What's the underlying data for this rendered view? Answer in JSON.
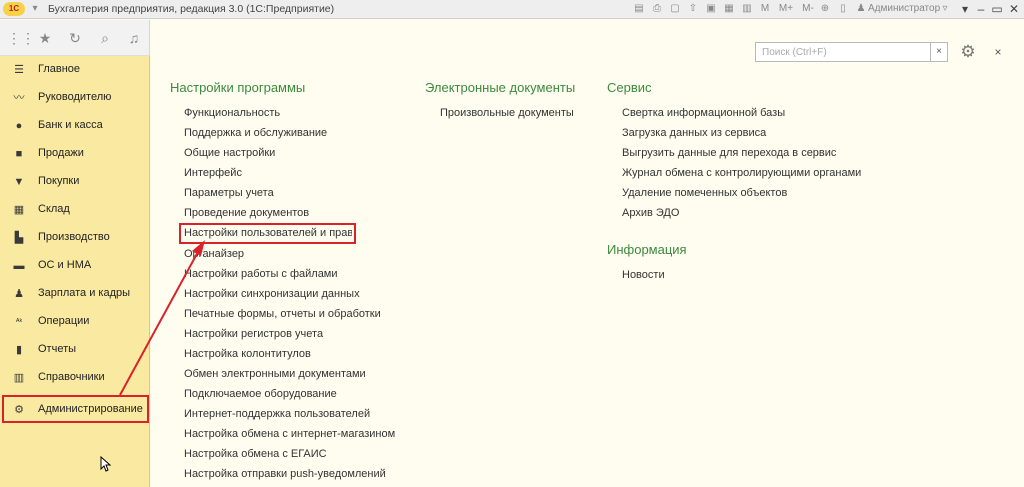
{
  "window": {
    "logo": "1С",
    "title": "Бухгалтерия предприятия, редакция 3.0  (1С:Предприятие)",
    "user": "Администратор",
    "toolbar_icons": [
      "save-icon",
      "print-icon",
      "preview-icon",
      "upload-icon",
      "clipboard-icon",
      "calendar-icon",
      "calculator-icon"
    ],
    "memory_labels": [
      "M",
      "M+",
      "M-"
    ]
  },
  "top_panel": {
    "icons": [
      "apps-grid-icon",
      "star-icon",
      "history-icon",
      "search-icon",
      "bell-icon"
    ]
  },
  "sidebar": {
    "items": [
      {
        "label": "Главное",
        "icon": "menu-lines-icon"
      },
      {
        "label": "Руководителю",
        "icon": "trend-icon"
      },
      {
        "label": "Банк и касса",
        "icon": "coin-icon"
      },
      {
        "label": "Продажи",
        "icon": "bag-icon"
      },
      {
        "label": "Покупки",
        "icon": "cart-icon"
      },
      {
        "label": "Склад",
        "icon": "warehouse-icon"
      },
      {
        "label": "Производство",
        "icon": "factory-icon"
      },
      {
        "label": "ОС и НМА",
        "icon": "truck-icon"
      },
      {
        "label": "Зарплата и кадры",
        "icon": "person-icon"
      },
      {
        "label": "Операции",
        "icon": "operations-icon"
      },
      {
        "label": "Отчеты",
        "icon": "bar-chart-icon"
      },
      {
        "label": "Справочники",
        "icon": "books-icon"
      },
      {
        "label": "Администрирование",
        "icon": "gear-icon"
      }
    ]
  },
  "search": {
    "placeholder": "Поиск (Ctrl+F)",
    "clear": "×"
  },
  "close_label": "×",
  "sections": {
    "settings": {
      "title": "Настройки программы",
      "links": [
        "Функциональность",
        "Поддержка и обслуживание",
        "Общие настройки",
        "Интерфейс",
        "Параметры учета",
        "Проведение документов",
        "Настройки пользователей и прав",
        "Органайзер",
        "Настройки работы с файлами",
        "Настройки синхронизации данных",
        "Печатные формы, отчеты и обработки",
        "Настройки регистров учета",
        "Настройка колонтитулов",
        "Обмен электронными документами",
        "Подключаемое оборудование",
        "Интернет-поддержка пользователей",
        "Настройка обмена с интернет-магазином",
        "Настройка обмена с ЕГАИС",
        "Настройка отправки push-уведомлений"
      ]
    },
    "edocs": {
      "title": "Электронные документы",
      "links": [
        "Произвольные документы"
      ]
    },
    "service": {
      "title": "Сервис",
      "links": [
        "Свертка информационной базы",
        "Загрузка данных из сервиса",
        "Выгрузить данные для перехода в сервис",
        "Журнал обмена с контролирующими органами",
        "Удаление помеченных объектов",
        "Архив ЭДО"
      ]
    },
    "info": {
      "title": "Информация",
      "links": [
        "Новости"
      ]
    }
  },
  "colors": {
    "section_heading": "#3c8a3e",
    "sidebar_bg": "#fae9a0",
    "highlight": "#d8232a",
    "page_bg": "#fefdf0"
  }
}
